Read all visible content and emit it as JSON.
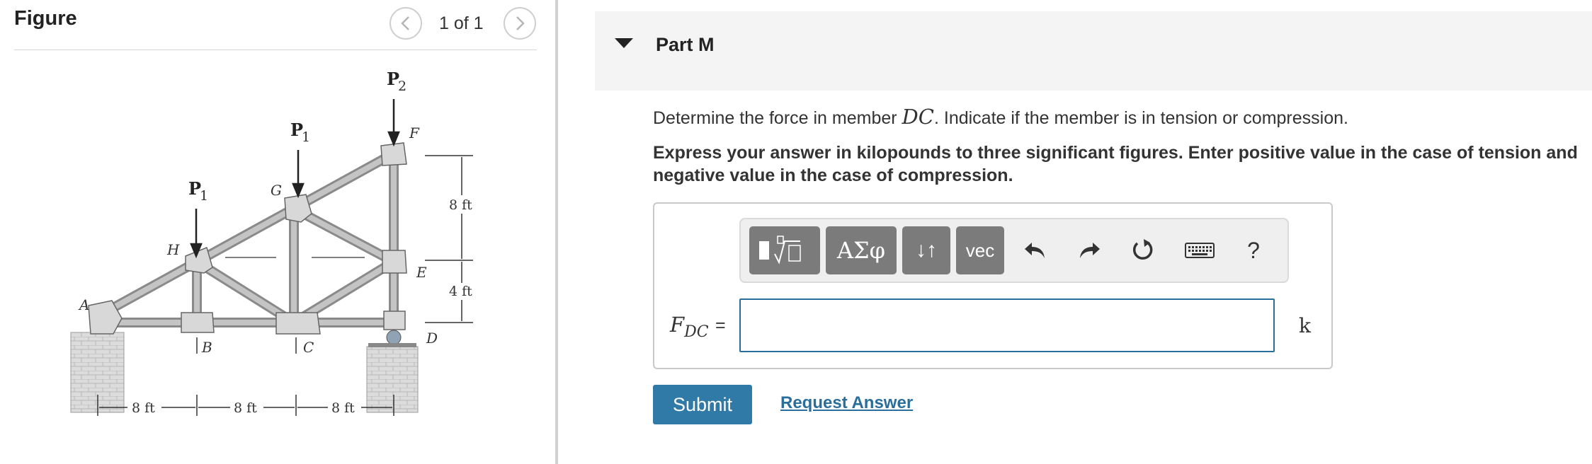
{
  "figure": {
    "title": "Figure",
    "pager": "1 of 1",
    "prev_icon": "chevron-left-icon",
    "next_icon": "chevron-right-icon",
    "truss": {
      "joint_labels": {
        "A": "A",
        "B": "B",
        "C": "C",
        "D": "D",
        "E": "E",
        "F": "F",
        "G": "G",
        "H": "H"
      },
      "loads": {
        "p1_left": "P1",
        "p1_mid": "P1",
        "p2": "P2"
      },
      "dimensions": {
        "span_1": "8 ft",
        "span_2": "8 ft",
        "span_3": "8 ft",
        "height_upper": "8 ft",
        "height_lower": "4 ft"
      }
    }
  },
  "part": {
    "label": "Part M",
    "question_before": "Determine the force in member ",
    "question_math": "DC",
    "question_after": ". Indicate if the member is in tension or compression.",
    "instructions": "Express your answer in kilopounds to three significant figures. Enter positive value in the case of tension and negative value in the case of compression."
  },
  "toolbar": {
    "greek_label": "ΑΣφ",
    "arrows_label": "↓↑",
    "vec_label": "vec",
    "help_label": "?",
    "icons": [
      "templates-icon",
      "undo-icon",
      "redo-icon",
      "reset-icon",
      "keyboard-icon",
      "help-icon"
    ]
  },
  "answer": {
    "variable": "F",
    "subscript": "DC",
    "equals": "=",
    "value": "",
    "unit": "k"
  },
  "actions": {
    "submit_label": "Submit",
    "request_label": "Request Answer"
  },
  "colors": {
    "accent": "#2f7aa6",
    "toolbar_button": "#7b7b7b",
    "header_bg": "#f4f4f4"
  }
}
